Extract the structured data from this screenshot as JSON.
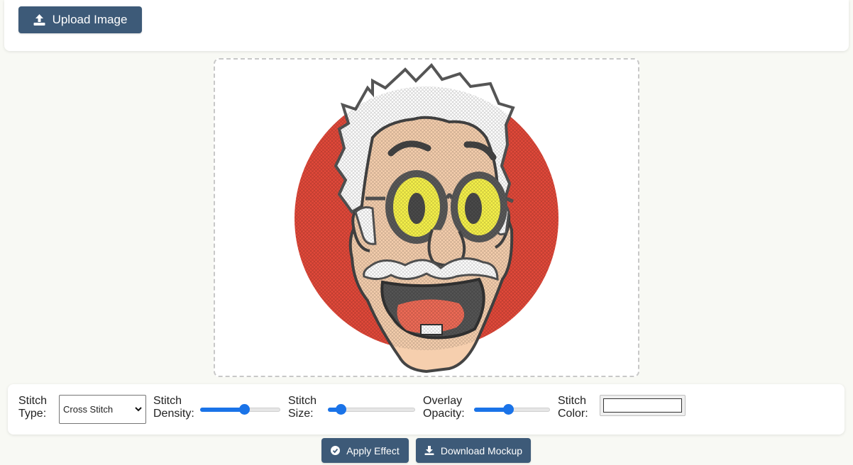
{
  "upload": {
    "label": "Upload Image",
    "icon": "upload-icon"
  },
  "controls": {
    "stitch_type": {
      "label_line1": "Stitch",
      "label_line2": "Type:",
      "value": "Cross Stitch"
    },
    "stitch_density": {
      "label_line1": "Stitch",
      "label_line2": "Density:",
      "value_pct": 55
    },
    "stitch_size": {
      "label_line1": "Stitch",
      "label_line2": "Size:",
      "value_pct": 15
    },
    "overlay_opacity": {
      "label_line1": "Overlay",
      "label_line2": "Opacity:",
      "value_pct": 45
    },
    "stitch_color": {
      "label_line1": "Stitch",
      "label_line2": "Color:",
      "value": "#ffffff"
    }
  },
  "actions": {
    "apply": {
      "label": "Apply Effect",
      "icon": "check-circle-icon"
    },
    "download": {
      "label": "Download Mockup",
      "icon": "download-icon"
    }
  },
  "colors": {
    "button_bg": "#3d5a78",
    "slider_accent": "#1a73e8",
    "background_circle": "#e2493a",
    "skin": "#f6cfae",
    "glasses_lens": "#f7f24a"
  }
}
